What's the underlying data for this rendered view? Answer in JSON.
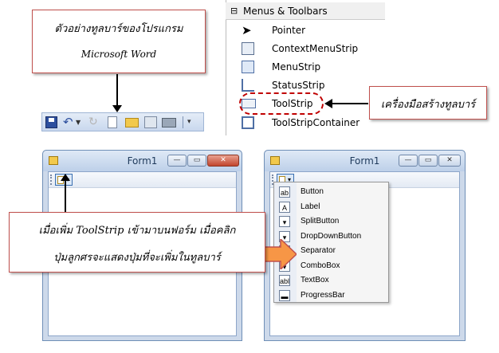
{
  "callout_word": {
    "line1": "ตัวอย่างทูลบาร์ของโปรแกรม",
    "line2": "Microsoft  Word"
  },
  "callout_tool": {
    "text": "เครื่องมือสร้างทูลบาร์"
  },
  "callout_form": {
    "line1": "เมื่อเพิ่ม ToolStrip  เข้ามาบนฟอร์ม เมื่อคลิก",
    "line2": "ปุ่มลูกศรจะแสดงปุ่มที่จะเพิ่มในทูลบาร์"
  },
  "toolbox": {
    "header": "Menus & Toolbars",
    "collapse_glyph": "⊟",
    "items": [
      {
        "label": "Pointer",
        "icon": "pointer-icon"
      },
      {
        "label": "ContextMenuStrip",
        "icon": "context-menu-icon"
      },
      {
        "label": "MenuStrip",
        "icon": "menustrip-icon"
      },
      {
        "label": "StatusStrip",
        "icon": "statusstrip-icon"
      },
      {
        "label": "ToolStrip",
        "icon": "toolstrip-icon"
      },
      {
        "label": "ToolStripContainer",
        "icon": "toolstrip-container-icon"
      }
    ]
  },
  "form_left": {
    "title": "Form1"
  },
  "form_right": {
    "title": "Form1"
  },
  "window_buttons": {
    "minimize": "—",
    "maximize": "▭",
    "close": "✕"
  },
  "dropdown": {
    "items": [
      {
        "label": "Button",
        "icon": "ab",
        "name": "button-icon"
      },
      {
        "label": "Label",
        "icon": "A",
        "name": "label-icon"
      },
      {
        "label": "SplitButton",
        "icon": "▾",
        "name": "splitbutton-icon"
      },
      {
        "label": "DropDownButton",
        "icon": "▾",
        "name": "dropdownbutton-icon"
      },
      {
        "label": "Separator",
        "icon": "|",
        "name": "separator-icon"
      },
      {
        "label": "ComboBox",
        "icon": "▾",
        "name": "combobox-icon"
      },
      {
        "label": "TextBox",
        "icon": "abl",
        "name": "textbox-icon"
      },
      {
        "label": "ProgressBar",
        "icon": "▬",
        "name": "progressbar-icon"
      }
    ]
  },
  "colors": {
    "callout_border": "#c0504d",
    "arrow_orange": "#f79646",
    "selection_border": "#c00000"
  }
}
